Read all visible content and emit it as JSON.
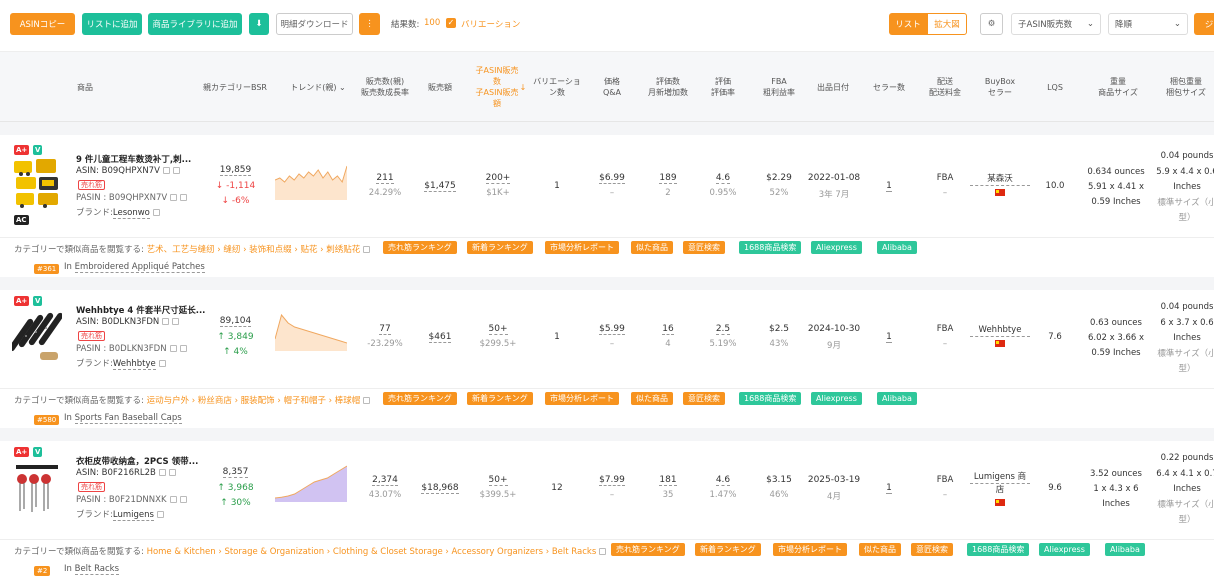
{
  "toolbar": {
    "asin_copy": "ASINコピー",
    "add_list": "リストに追加",
    "add_library": "商品ライブラリに追加",
    "detail_download": "明細ダウンロード",
    "result_label": "結果数:",
    "result_count": "100",
    "variation_label": "バリエーション",
    "view_list": "リスト",
    "view_zoom": "拡大図",
    "sort_field": "子ASIN販売数",
    "sort_order": "降順",
    "extra_button": "ジ"
  },
  "header": {
    "product": "商品",
    "parent_bsr": "親カテゴリーBSR",
    "trend": "トレンド(親)",
    "sales_l1": "販売数(親)",
    "sales_l2": "販売数成長率",
    "revenue": "販売額",
    "child_l1": "子ASIN販売",
    "child_l2": "数",
    "child_l3": "子ASIN販売",
    "child_l4": "額",
    "variations_l1": "バリエーショ",
    "variations_l2": "ン数",
    "price_l1": "価格",
    "price_l2": "Q&A",
    "reviews_l1": "評価数",
    "reviews_l2": "月新増加数",
    "rating_l1": "評価",
    "rating_l2": "評価率",
    "fba_l1": "FBA",
    "fba_l2": "粗利益率",
    "date": "出品日付",
    "sellers": "セラー数",
    "ship_l1": "配送",
    "ship_l2": "配送料金",
    "buybox_l1": "BuyBox",
    "buybox_l2": "セラー",
    "lqs": "LQS",
    "weight_l1": "重量",
    "weight_l2": "商品サイズ",
    "pkg_l1": "梱包重量",
    "pkg_l2": "梱包サイズ"
  },
  "rows": [
    {
      "title": "9 件儿童工程车数烫补丁,刺...",
      "asin": "ASIN: B09QHPXN7V",
      "hot": "売れ筋",
      "pasin": "PASIN : B09QHPXN7V",
      "brand_label": "ブランド:",
      "brand": "Lesonwo",
      "bsr": "19,859",
      "bsr_change": "↓ -1,114",
      "bsr_pct": "↓ -6%",
      "sales": "211",
      "sales_growth": "24.29%",
      "revenue": "$1,475",
      "child_sales": "200+",
      "child_revenue": "$1K+",
      "variations": "1",
      "price": "$6.99",
      "qa": "–",
      "reviews": "189",
      "reviews_new": "2",
      "rating": "4.6",
      "rating_rate": "0.95%",
      "fba": "$2.29",
      "margin": "52%",
      "date": "2022-01-08",
      "age": "3年 7月",
      "sellers": "1",
      "shipping": "FBA",
      "ship_fee": "–",
      "buybox": "某森沃",
      "lqs": "10.0",
      "weight": "0.634 ounces",
      "size_l1": "5.91 x 4.41 x",
      "size_l2": "0.59 Inches",
      "pkg_weight": "0.04 pounds",
      "pkg_l1": "5.9 x 4.4 x 0.6",
      "pkg_l2": "Inches",
      "pkg_l3": "標準サイズ（小",
      "pkg_l4": "型）",
      "cat_prefix": "カテゴリーで類似商品を閲覧する:",
      "cat_path": "艺术、工艺与缝纫 › 缝纫 › 装饰和点缀 › 贴花 › 刺绣贴花",
      "rank": "#361",
      "rank_in": "In",
      "rank_cat": "Embroidered Appliqué Patches",
      "spark_color": "#f0a860",
      "spark": [
        0.5,
        0.55,
        0.45,
        0.6,
        0.5,
        0.65,
        0.55,
        0.7,
        0.6,
        0.75,
        0.55,
        0.7,
        0.5,
        0.6,
        0.45,
        0.85
      ]
    },
    {
      "title": "Wehhbtye 4 件套半尺寸延长...",
      "asin": "ASIN: B0DLKN3FDN",
      "hot": "売れ筋",
      "pasin": "PASIN : B0DLKN3FDN",
      "brand_label": "ブランド:",
      "brand": "Wehhbtye",
      "bsr": "89,104",
      "bsr_change": "↑ 3,849",
      "bsr_pct": "↑ 4%",
      "sales": "77",
      "sales_growth": "-23.29%",
      "revenue": "$461",
      "child_sales": "50+",
      "child_revenue": "$299.5+",
      "variations": "1",
      "price": "$5.99",
      "qa": "–",
      "reviews": "16",
      "reviews_new": "4",
      "rating": "2.5",
      "rating_rate": "5.19%",
      "fba": "$2.5",
      "margin": "43%",
      "date": "2024-10-30",
      "age": "9月",
      "sellers": "1",
      "shipping": "FBA",
      "ship_fee": "–",
      "buybox": "Wehhbtye",
      "lqs": "7.6",
      "weight": "0.63 ounces",
      "size_l1": "6.02 x 3.66 x",
      "size_l2": "0.59 Inches",
      "pkg_weight": "0.04 pounds",
      "pkg_l1": "6 x 3.7 x 0.6",
      "pkg_l2": "Inches",
      "pkg_l3": "標準サイズ（小",
      "pkg_l4": "型）",
      "cat_prefix": "カテゴリーで類似商品を閲覧する:",
      "cat_path": "运动与户外 › 粉丝商店 › 服装配饰 › 帽子和帽子 › 棒球帽",
      "rank": "#580",
      "rank_in": "In",
      "rank_cat": "Sports Fan Baseball Caps",
      "spark_color": "#f0a860",
      "spark": [
        0.3,
        0.9,
        0.7,
        0.6,
        0.55,
        0.5,
        0.45,
        0.4,
        0.35,
        0.3,
        0.25,
        0.2
      ]
    },
    {
      "title": "衣柜皮带收纳盒，2PCS 领带...",
      "asin": "ASIN: B0F216RL2B",
      "hot": "売れ筋",
      "pasin": "PASIN : B0F21DNNXK",
      "brand_label": "ブランド:",
      "brand": "Lumigens",
      "bsr": "8,357",
      "bsr_change": "↑ 3,968",
      "bsr_pct": "↑ 30%",
      "sales": "2,374",
      "sales_growth": "43.07%",
      "revenue": "$18,968",
      "child_sales": "50+",
      "child_revenue": "$399.5+",
      "variations": "12",
      "price": "$7.99",
      "qa": "–",
      "reviews": "181",
      "reviews_new": "35",
      "rating": "4.6",
      "rating_rate": "1.47%",
      "fba": "$3.15",
      "margin": "46%",
      "date": "2025-03-19",
      "age": "4月",
      "sellers": "1",
      "shipping": "FBA",
      "ship_fee": "–",
      "buybox_l1": "Lumigens 商",
      "buybox_l2": "店",
      "lqs": "9.6",
      "weight": "3.52 ounces",
      "size_l1": "1 x 4.3 x 6",
      "size_l2": "Inches",
      "pkg_weight": "0.22 pounds",
      "pkg_l1": "6.4 x 4.1 x 0.7",
      "pkg_l2": "Inches",
      "pkg_l3": "標準サイズ（小",
      "pkg_l4": "型）",
      "cat_prefix": "カテゴリーで類似商品を閲覧する:",
      "cat_path": "Home & Kitchen › Storage & Organization › Clothing & Closet Storage › Accessory Organizers › Belt Racks",
      "rank": "#2",
      "rank_in": "In",
      "rank_cat": "Belt Racks",
      "spark_color": "#f0a860",
      "spark": [
        0.1,
        0.12,
        0.15,
        0.2,
        0.3,
        0.4,
        0.5,
        0.55,
        0.6,
        0.7,
        0.8,
        0.9
      ]
    }
  ],
  "tags": {
    "ranking_hot": "売れ筋ランキング",
    "ranking_new": "新着ランキング",
    "market": "市場分析レポート",
    "similar": "似た商品",
    "patent": "意匠検索",
    "s1688": "1688商品検索",
    "aliexpress": "Aliexpress",
    "alibaba": "Alibaba"
  },
  "colors": {
    "accent": "#f7931e",
    "green": "#1dbf9a"
  }
}
